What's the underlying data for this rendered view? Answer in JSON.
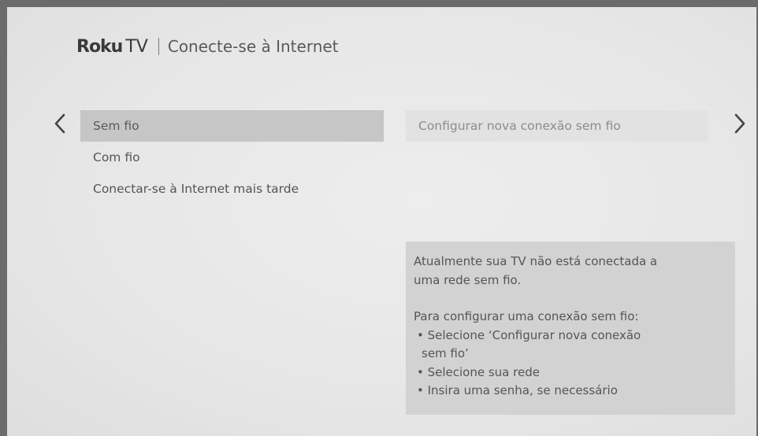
{
  "header": {
    "logo_brand": "Roku",
    "logo_suffix": "TV",
    "title": "Conecte-se à Internet"
  },
  "nav": {
    "left_icon": "chevron-left-icon",
    "right_icon": "chevron-right-icon"
  },
  "menu": {
    "items": [
      {
        "label": "Sem fio",
        "selected": true
      },
      {
        "label": "Com fio",
        "selected": false
      },
      {
        "label": "Conectar-se à Internet mais tarde",
        "selected": false
      }
    ]
  },
  "submenu": {
    "option": "Configurar nova conexão sem fio"
  },
  "info": {
    "status_line1": "Atualmente sua TV não está conectada a",
    "status_line2": "uma rede sem fio.",
    "instructions_heading": "Para configurar uma conexão sem fio:",
    "bullet1_line1": "• Selecione ‘Configurar nova conexão",
    "bullet1_line2": "sem fio’",
    "bullet2": "• Selecione sua rede",
    "bullet3": "• Insira uma senha, se necessário"
  },
  "colors": {
    "frame_border": "#6b6b6b",
    "background": "#e7e7e7",
    "selected_item": "#c6c6c6",
    "info_box": "#d2d2d2"
  }
}
